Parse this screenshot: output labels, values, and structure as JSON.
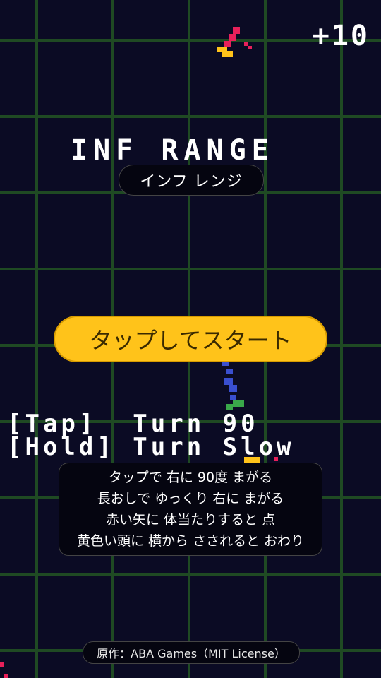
{
  "game": {
    "score": "+10",
    "title": "INF RANGE",
    "subtitle": "インフ レンジ",
    "start_label": "タップしてスタート",
    "controls": {
      "tap": "[Tap]  Turn 90",
      "hold": "[Hold] Turn Slow"
    },
    "instructions": [
      "タップで 右に 90度 まがる",
      "長おしで ゆっくり 右に まがる",
      "赤い矢に 体当たりすると 点",
      "黄色い頭に 横から さされると おわり"
    ],
    "credit": "原作：ABA Games（MIT License）"
  },
  "colors": {
    "background": "#0b0b24",
    "grid": "#1f4a23",
    "start_button": "#ffc31a",
    "arrow_red": "#e8205a",
    "head_yellow": "#ffc31a",
    "player_blue": "#3a4fd0",
    "player_green": "#3aa84a"
  }
}
